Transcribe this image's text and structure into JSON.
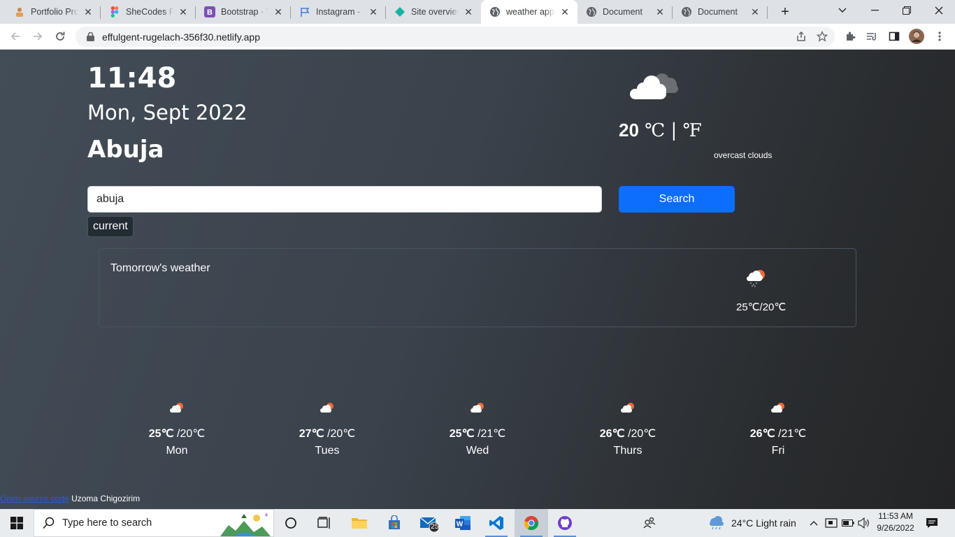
{
  "browser": {
    "tabs": [
      {
        "label": "Portfolio Proje",
        "icon": "portfolio-favicon",
        "active": false
      },
      {
        "label": "SheCodes Res",
        "icon": "figma-favicon",
        "active": false
      },
      {
        "label": "Bootstrap · Th",
        "icon": "bootstrap-favicon",
        "active": false
      },
      {
        "label": "Instagram - [",
        "icon": "flag-favicon",
        "active": false
      },
      {
        "label": "Site overview",
        "icon": "netlify-favicon",
        "active": false
      },
      {
        "label": "weather app",
        "icon": "globe-favicon",
        "active": true
      },
      {
        "label": "Document",
        "icon": "globe-favicon",
        "active": false
      },
      {
        "label": "Document",
        "icon": "globe-favicon",
        "active": false
      }
    ],
    "url": "effulgent-rugelach-356f30.netlify.app"
  },
  "weather": {
    "time": "11:48",
    "date": "Mon, Sept 2022",
    "city": "Abuja",
    "temperature": "20",
    "units": " ℃ | ℉",
    "description": "overcast clouds",
    "search_value": "abuja",
    "search_button": "Search",
    "current_button": "current",
    "tomorrow": {
      "title": "Tomorrow's weather",
      "temp": "25℃/20℃"
    },
    "forecast": [
      {
        "max": "25℃",
        "min": " /20℃",
        "day": "Mon"
      },
      {
        "max": "27℃",
        "min": " /20℃",
        "day": "Tues"
      },
      {
        "max": "25℃",
        "min": " /21℃",
        "day": "Wed"
      },
      {
        "max": "26℃",
        "min": " /20℃",
        "day": "Thurs"
      },
      {
        "max": "26℃",
        "min": " /21℃",
        "day": "Fri"
      }
    ],
    "footer": {
      "link": "Open-source code",
      "author": " Uzoma Chigozirim"
    }
  },
  "taskbar": {
    "search_placeholder": "Type here to search",
    "mail_badge": "25",
    "weather": "24°C  Light rain",
    "clock_time": "11:53 AM",
    "clock_date": "9/26/2022"
  },
  "colors": {
    "accent": "#0d6efd",
    "page_bg": "#3a424b"
  }
}
